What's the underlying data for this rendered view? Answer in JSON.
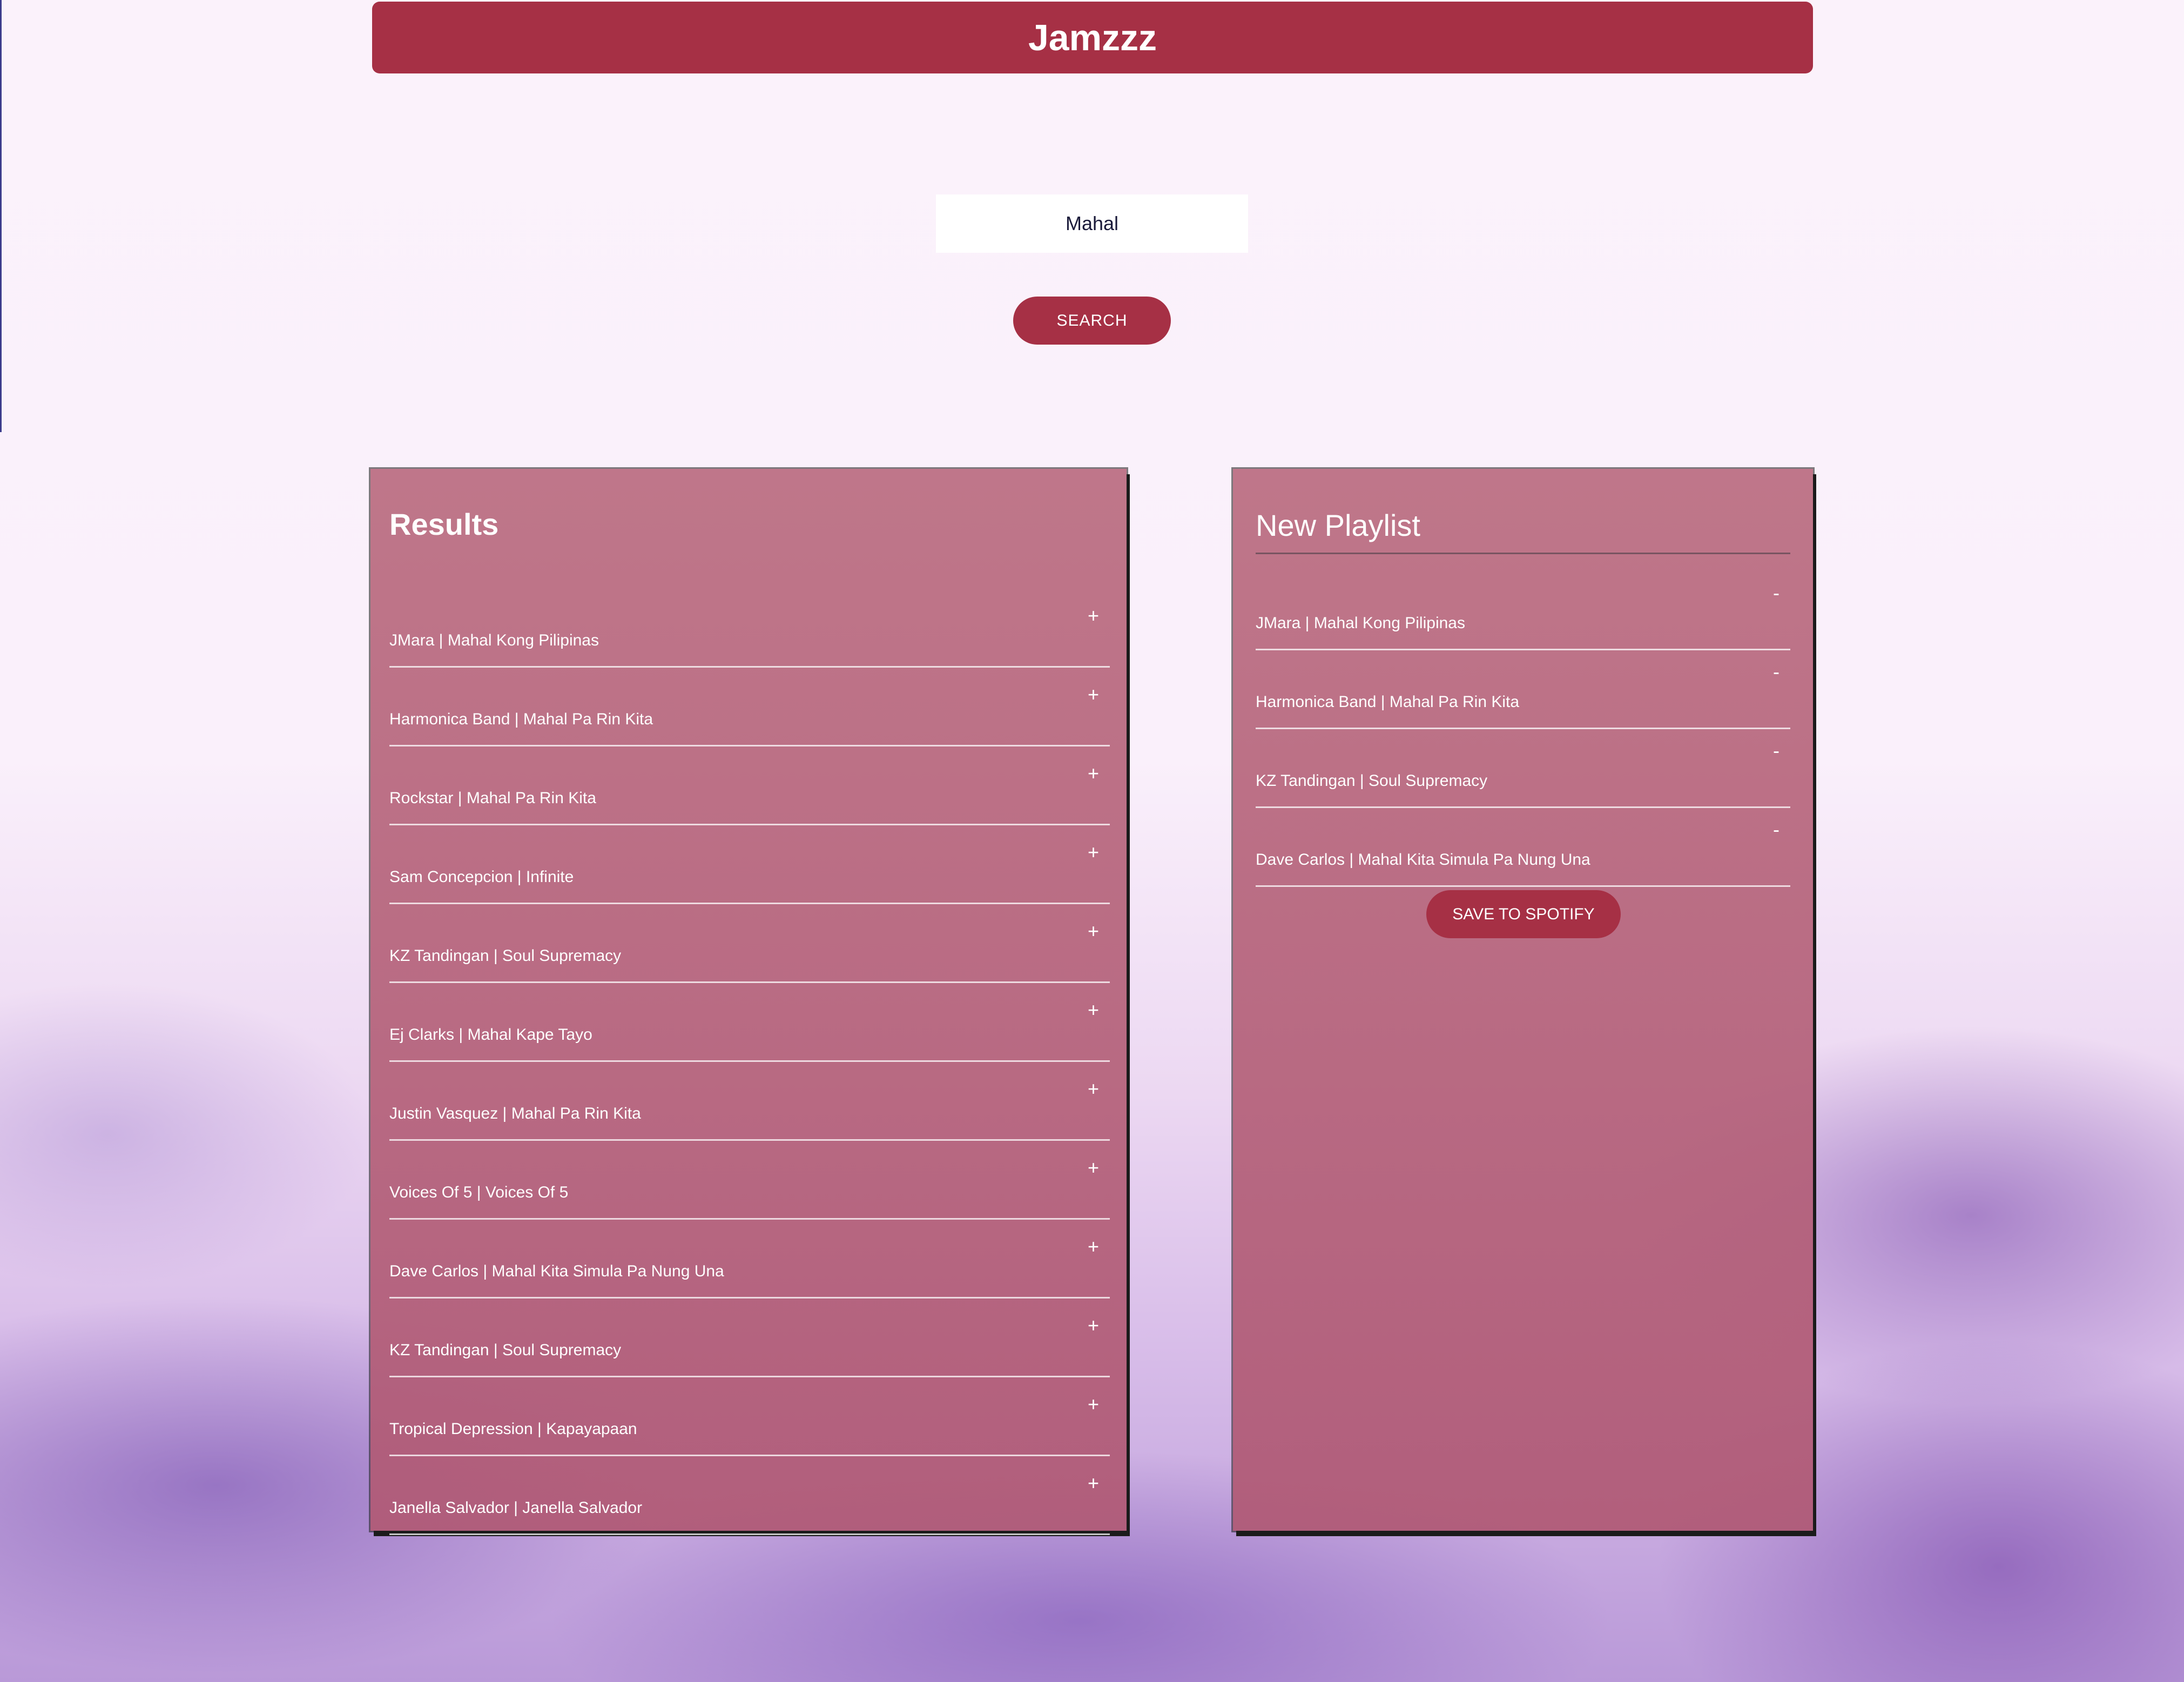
{
  "app": {
    "title": "Jamzzz"
  },
  "search": {
    "value": "Mahal",
    "button_label": "SEARCH"
  },
  "results": {
    "title": "Results",
    "add_symbol": "+",
    "tracks": [
      "JMara | Mahal Kong Pilipinas",
      "Harmonica Band | Mahal Pa Rin Kita",
      "Rockstar | Mahal Pa Rin Kita",
      "Sam Concepcion | Infinite",
      "KZ Tandingan | Soul Supremacy",
      "Ej Clarks | Mahal Kape Tayo",
      "Justin Vasquez | Mahal Pa Rin Kita",
      "Voices Of 5 | Voices Of 5",
      "Dave Carlos | Mahal Kita Simula Pa Nung Una",
      "KZ Tandingan | Soul Supremacy",
      "Tropical Depression | Kapayapaan",
      "Janella Salvador | Janella Salvador"
    ]
  },
  "playlist": {
    "title": "New Playlist",
    "remove_symbol": "-",
    "tracks": [
      "JMara | Mahal Kong Pilipinas",
      "Harmonica Band | Mahal Pa Rin Kita",
      "KZ Tandingan | Soul Supremacy",
      "Dave Carlos | Mahal Kita Simula Pa Nung Una"
    ],
    "save_label": "SAVE TO SPOTIFY"
  },
  "colors": {
    "accent": "#a63045",
    "panel": "#b86c80",
    "background": "#fbf1fb"
  }
}
